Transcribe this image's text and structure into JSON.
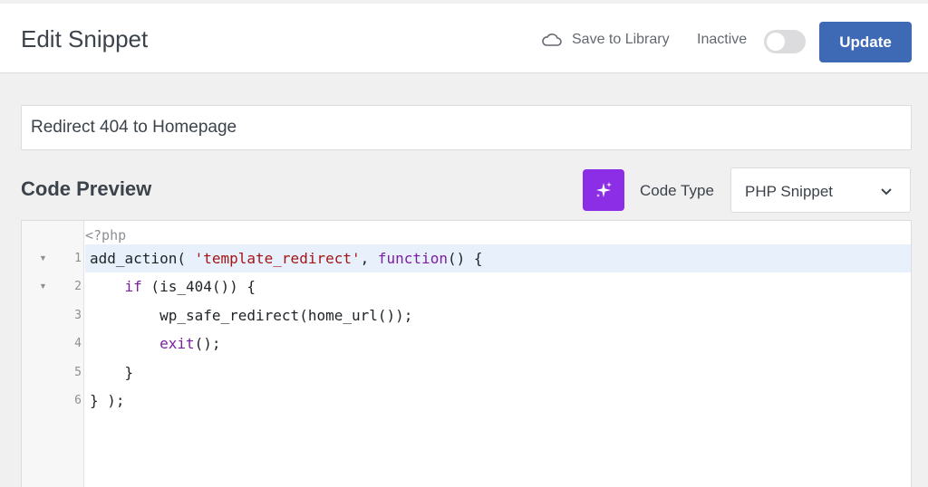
{
  "header": {
    "title": "Edit Snippet",
    "save_to_library": "Save to Library",
    "status": "Inactive",
    "update": "Update"
  },
  "snippet": {
    "title_value": "Redirect 404 to Homepage"
  },
  "code_preview": {
    "title": "Code Preview",
    "code_type_label": "Code Type",
    "code_type_value": "PHP Snippet",
    "php_open_tag": "<?php",
    "lines": [
      {
        "num": "1",
        "parts": [
          "add_action( ",
          "'template_redirect'",
          ", ",
          "function",
          "() {"
        ]
      },
      {
        "num": "2",
        "parts": [
          "    ",
          "if",
          " (is_404()) {"
        ]
      },
      {
        "num": "3",
        "text": "        wp_safe_redirect(home_url());"
      },
      {
        "num": "4",
        "parts": [
          "        ",
          "exit",
          "();"
        ]
      },
      {
        "num": "5",
        "text": "    }"
      },
      {
        "num": "6",
        "text": "} );"
      }
    ]
  },
  "icons": {
    "save": "cloud-icon",
    "ai": "sparkle-icon",
    "select": "chevron-down-icon",
    "fold": "fold-arrow-icon"
  },
  "colors": {
    "accent": "#3e6ab5",
    "ai_button": "#8b2ee6",
    "active_line": "#e8f1fb",
    "string": "#a31515",
    "keyword": "#7a1fa2"
  }
}
